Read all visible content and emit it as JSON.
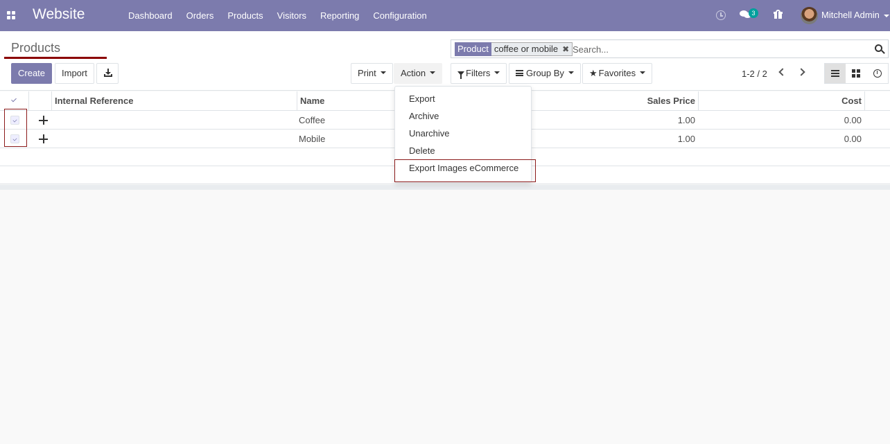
{
  "navbar": {
    "brand": "Website",
    "menu": [
      "Dashboard",
      "Orders",
      "Products",
      "Visitors",
      "Reporting",
      "Configuration"
    ],
    "chat_count": "3",
    "user_name": "Mitchell Admin",
    "bg_color": "#7c7bad"
  },
  "control": {
    "breadcrumb": "Products",
    "create_label": "Create",
    "import_label": "Import",
    "print_label": "Print",
    "action_label": "Action",
    "filters_label": "Filters",
    "groupby_label": "Group By",
    "favorites_label": "Favorites",
    "pager": "1-2 / 2"
  },
  "search": {
    "facet_category": "Product",
    "facet_value": "coffee or mobile",
    "placeholder": "Search..."
  },
  "action_menu": {
    "items": [
      "Export",
      "Archive",
      "Unarchive",
      "Delete",
      "Export Images eCommerce"
    ]
  },
  "table": {
    "columns": [
      "Internal Reference",
      "Name",
      "Sales Price",
      "Cost"
    ],
    "rows": [
      {
        "ref": "",
        "name": "Coffee",
        "sales_price": "1.00",
        "cost": "0.00",
        "selected": true
      },
      {
        "ref": "",
        "name": "Mobile",
        "sales_price": "1.00",
        "cost": "0.00",
        "selected": true
      }
    ]
  },
  "accent_color": "#8b1a1a"
}
